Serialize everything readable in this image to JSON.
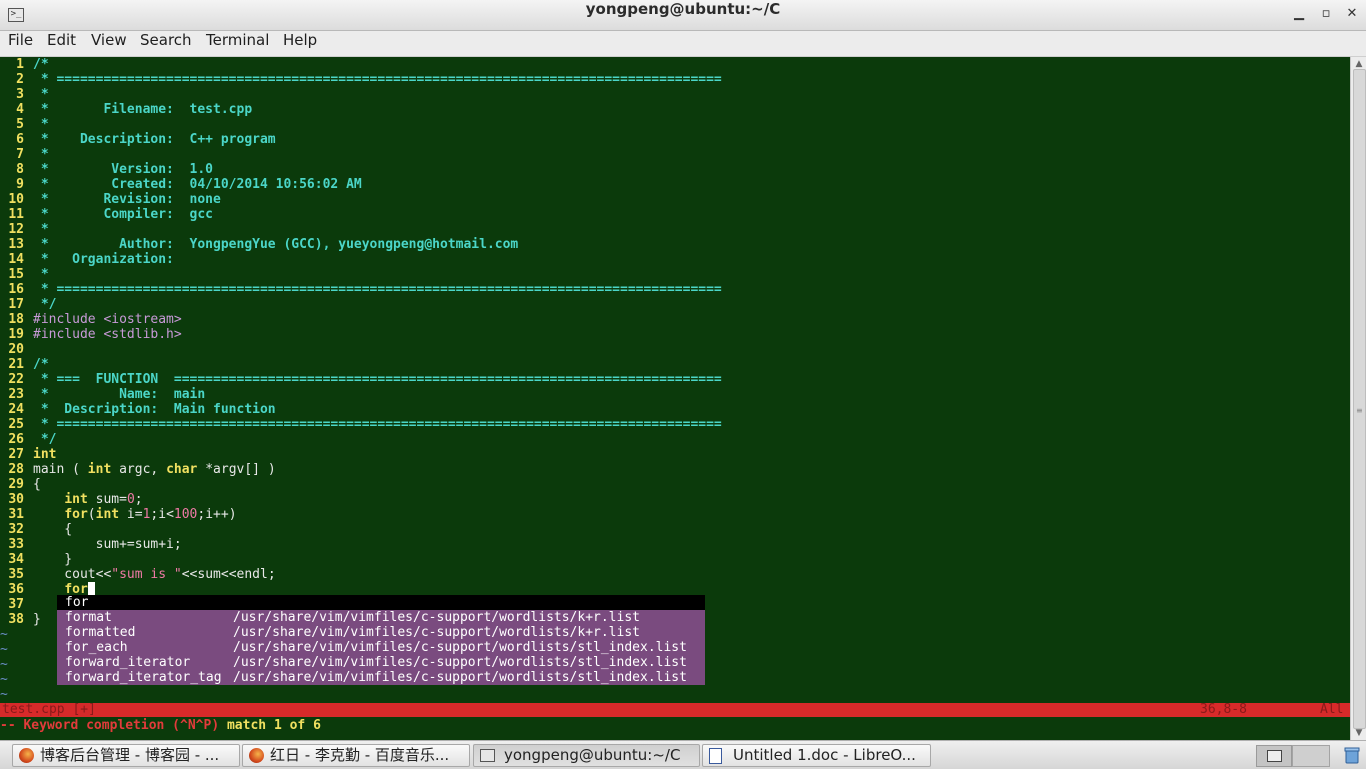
{
  "window": {
    "title": "yongpeng@ubuntu:~/C",
    "minimize": "▁",
    "maximize": "▫",
    "close": "✕"
  },
  "menu": [
    "File",
    "Edit",
    "View",
    "Search",
    "Terminal",
    "Help"
  ],
  "editor": {
    "lines": [
      {
        "n": "1",
        "segs": [
          [
            "cm",
            "/*"
          ]
        ]
      },
      {
        "n": "2",
        "segs": [
          [
            "cm",
            " * ====================================================================================="
          ]
        ]
      },
      {
        "n": "3",
        "segs": [
          [
            "cm",
            " *"
          ]
        ]
      },
      {
        "n": "4",
        "segs": [
          [
            "cm",
            " *       Filename:  test.cpp"
          ]
        ]
      },
      {
        "n": "5",
        "segs": [
          [
            "cm",
            " *"
          ]
        ]
      },
      {
        "n": "6",
        "segs": [
          [
            "cm",
            " *    Description:  C++ program"
          ]
        ]
      },
      {
        "n": "7",
        "segs": [
          [
            "cm",
            " *"
          ]
        ]
      },
      {
        "n": "8",
        "segs": [
          [
            "cm",
            " *        Version:  1.0"
          ]
        ]
      },
      {
        "n": "9",
        "segs": [
          [
            "cm",
            " *        Created:  04/10/2014 10:56:02 AM"
          ]
        ]
      },
      {
        "n": "10",
        "segs": [
          [
            "cm",
            " *       Revision:  none"
          ]
        ]
      },
      {
        "n": "11",
        "segs": [
          [
            "cm",
            " *       Compiler:  gcc"
          ]
        ]
      },
      {
        "n": "12",
        "segs": [
          [
            "cm",
            " *"
          ]
        ]
      },
      {
        "n": "13",
        "segs": [
          [
            "cm",
            " *         Author:  YongpengYue (GCC), yueyongpeng@hotmail.com"
          ]
        ]
      },
      {
        "n": "14",
        "segs": [
          [
            "cm",
            " *   Organization:"
          ]
        ]
      },
      {
        "n": "15",
        "segs": [
          [
            "cm",
            " *"
          ]
        ]
      },
      {
        "n": "16",
        "segs": [
          [
            "cm",
            " * ====================================================================================="
          ]
        ]
      },
      {
        "n": "17",
        "segs": [
          [
            "cm",
            " */"
          ]
        ]
      },
      {
        "n": "18",
        "segs": [
          [
            "pp",
            "#include <iostream>"
          ]
        ]
      },
      {
        "n": "19",
        "segs": [
          [
            "pp",
            "#include <stdlib.h>"
          ]
        ]
      },
      {
        "n": "20",
        "segs": []
      },
      {
        "n": "21",
        "segs": [
          [
            "cm",
            "/*"
          ]
        ]
      },
      {
        "n": "22",
        "segs": [
          [
            "cm",
            " * ===  FUNCTION  ======================================================================"
          ]
        ]
      },
      {
        "n": "23",
        "segs": [
          [
            "cm",
            " *         Name:  main"
          ]
        ]
      },
      {
        "n": "24",
        "segs": [
          [
            "cm",
            " *  Description:  Main function"
          ]
        ]
      },
      {
        "n": "25",
        "segs": [
          [
            "cm",
            " * ====================================================================================="
          ]
        ]
      },
      {
        "n": "26",
        "segs": [
          [
            "cm",
            " */"
          ]
        ]
      },
      {
        "n": "27",
        "segs": [
          [
            "ty",
            "int"
          ]
        ]
      },
      {
        "n": "28",
        "segs": [
          [
            "pl",
            "main ( "
          ],
          [
            "ty",
            "int"
          ],
          [
            "pl",
            " argc, "
          ],
          [
            "ty",
            "char"
          ],
          [
            "pl",
            " *argv[] )"
          ]
        ]
      },
      {
        "n": "29",
        "segs": [
          [
            "pl",
            "{"
          ]
        ]
      },
      {
        "n": "30",
        "segs": [
          [
            "pl",
            "    "
          ],
          [
            "ty",
            "int"
          ],
          [
            "pl",
            " sum="
          ],
          [
            "nm",
            "0"
          ],
          [
            "pl",
            ";"
          ]
        ]
      },
      {
        "n": "31",
        "segs": [
          [
            "pl",
            "    "
          ],
          [
            "ty",
            "for"
          ],
          [
            "pl",
            "("
          ],
          [
            "ty",
            "int"
          ],
          [
            "pl",
            " i="
          ],
          [
            "nm",
            "1"
          ],
          [
            "pl",
            ";i<"
          ],
          [
            "nm",
            "100"
          ],
          [
            "pl",
            ";i++)"
          ]
        ]
      },
      {
        "n": "32",
        "segs": [
          [
            "pl",
            "    {"
          ]
        ]
      },
      {
        "n": "33",
        "segs": [
          [
            "pl",
            "        sum+=sum+i;"
          ]
        ]
      },
      {
        "n": "34",
        "segs": [
          [
            "pl",
            "    }"
          ]
        ]
      },
      {
        "n": "35",
        "segs": [
          [
            "pl",
            "    cout<<"
          ],
          [
            "st",
            "\"sum is \""
          ],
          [
            "pl",
            "<<sum<<endl;"
          ]
        ]
      },
      {
        "n": "36",
        "segs": [
          [
            "pl",
            "    "
          ],
          [
            "ty",
            "for"
          ]
        ]
      },
      {
        "n": "37",
        "segs": []
      },
      {
        "n": "38",
        "segs": [
          [
            "pl",
            "}"
          ]
        ]
      }
    ],
    "tildes": [
      "~",
      "~",
      "~",
      "~",
      "~"
    ]
  },
  "popup": {
    "items": [
      {
        "word": "for",
        "path": ""
      },
      {
        "word": "format",
        "path": "/usr/share/vim/vimfiles/c-support/wordlists/k+r.list"
      },
      {
        "word": "formatted",
        "path": "/usr/share/vim/vimfiles/c-support/wordlists/k+r.list"
      },
      {
        "word": "for_each",
        "path": "/usr/share/vim/vimfiles/c-support/wordlists/stl_index.list"
      },
      {
        "word": "forward_iterator",
        "path": "/usr/share/vim/vimfiles/c-support/wordlists/stl_index.list"
      },
      {
        "word": "forward_iterator_tag",
        "path": "/usr/share/vim/vimfiles/c-support/wordlists/stl_index.list"
      }
    ]
  },
  "statusline": {
    "file": "test.cpp [+]",
    "pos": "36,8-8",
    "pct": "All"
  },
  "message": {
    "mode": "-- Keyword completion (^N^P)",
    "match": "match 1 of 6"
  },
  "taskbar": {
    "tasks": [
      {
        "label": "博客后台管理 - 博客园 - ...",
        "icon": "firefox-icon"
      },
      {
        "label": "红日 - 李克勤 - 百度音乐...",
        "icon": "firefox-icon"
      },
      {
        "label": "yongpeng@ubuntu:~/C",
        "icon": "terminal-icon"
      },
      {
        "label": "Untitled 1.doc - LibreO...",
        "icon": "document-icon"
      }
    ]
  }
}
